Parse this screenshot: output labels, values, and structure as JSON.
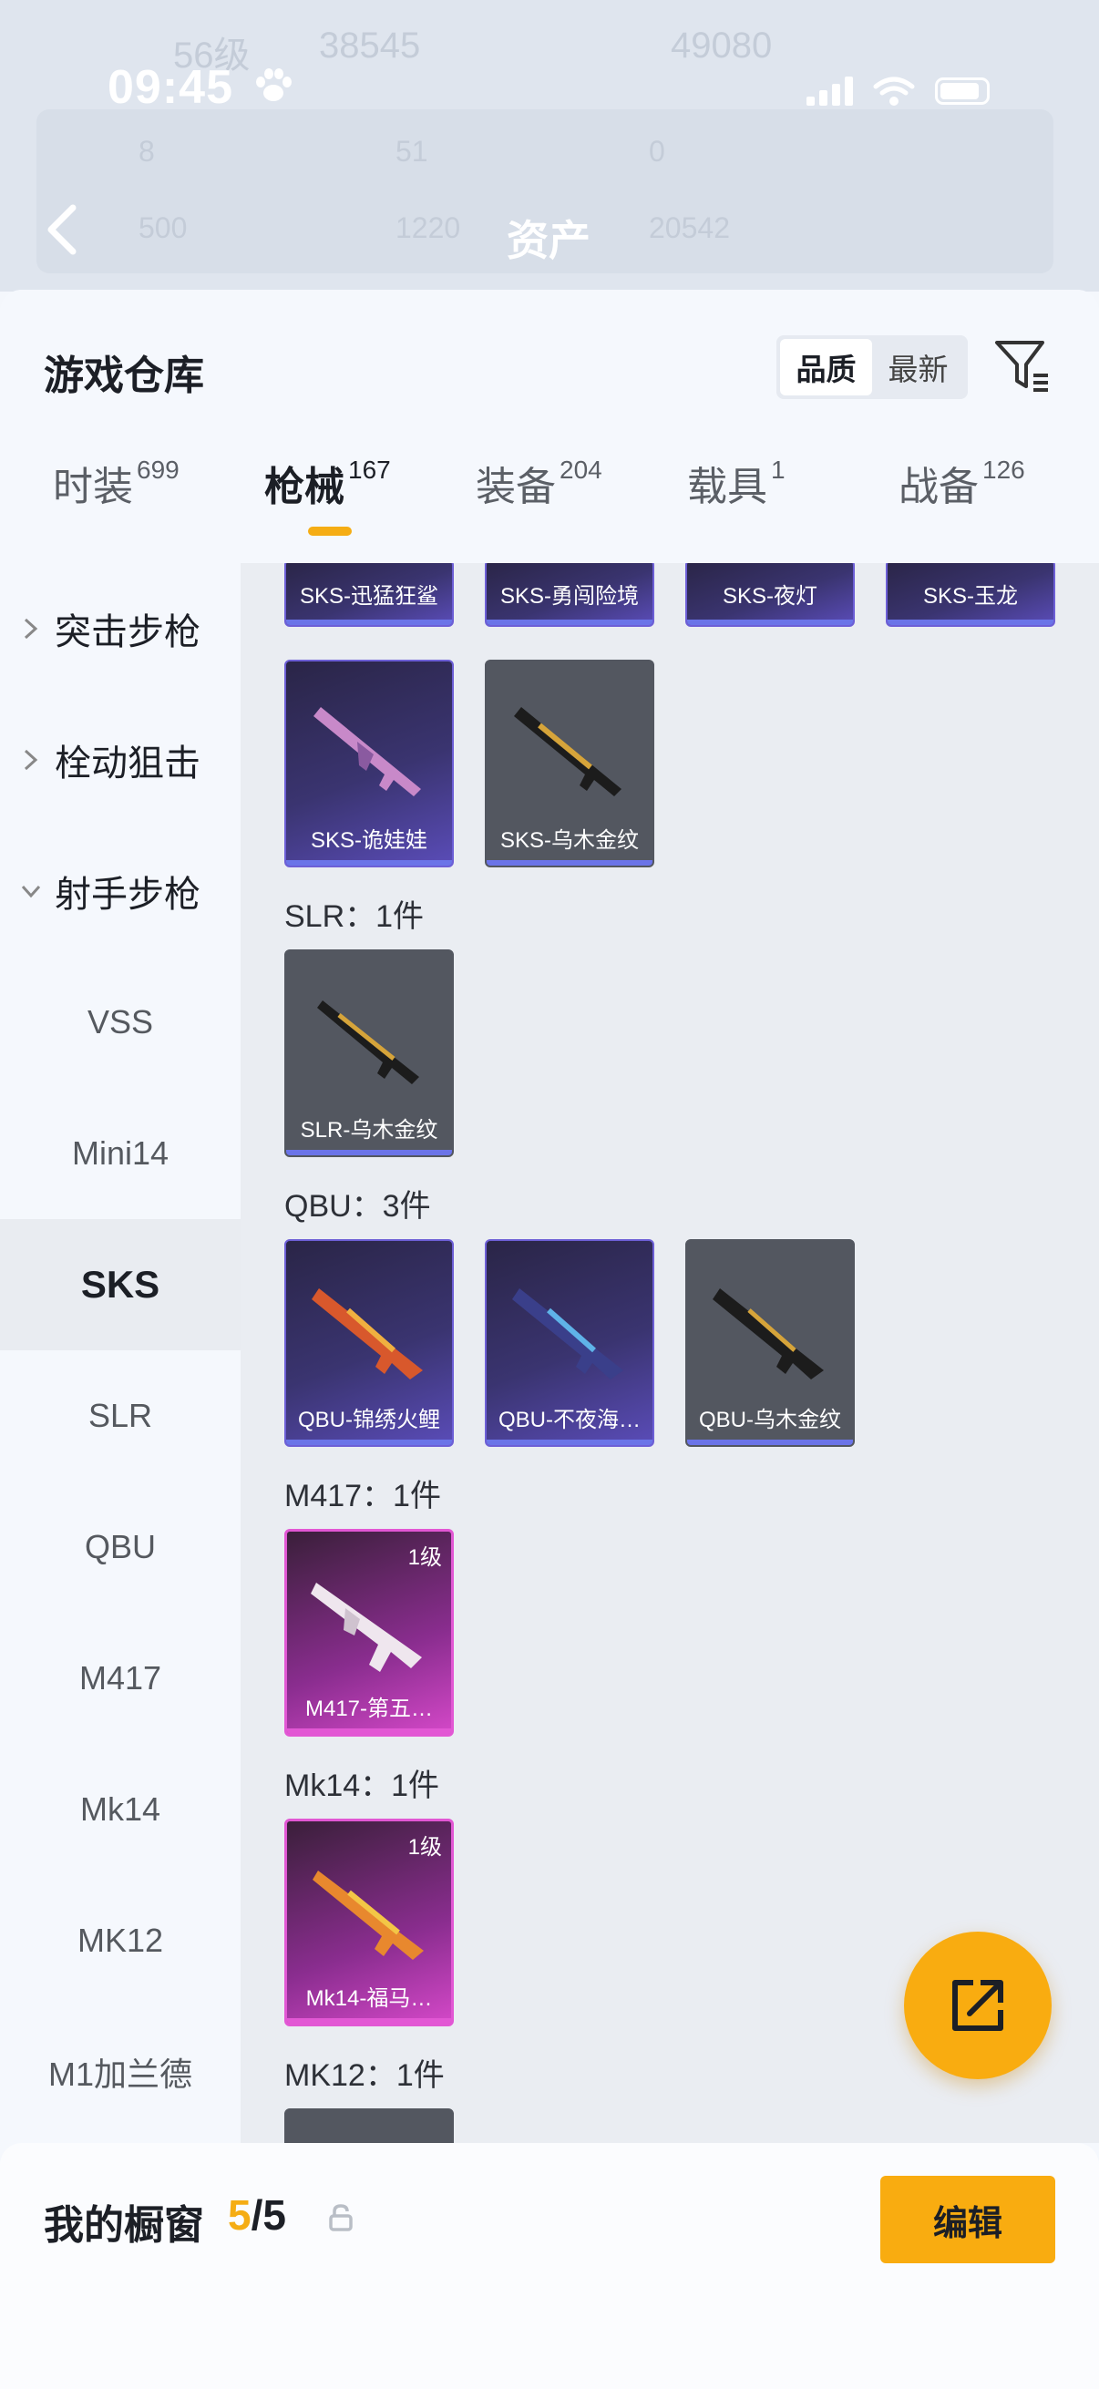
{
  "status_bar": {
    "time": "09:45",
    "level_text": "56级",
    "score_left": "38545",
    "score_right": "49080"
  },
  "background_page": {
    "title": "资产",
    "stats_row1": [
      "8",
      "51",
      "0"
    ],
    "stats_row2": [
      "500",
      "1220",
      "20542"
    ]
  },
  "sheet": {
    "title": "游戏仓库",
    "sort_options": [
      "品质",
      "最新"
    ],
    "sort_selected": "品质"
  },
  "tabs": [
    {
      "label": "时装",
      "count": "699"
    },
    {
      "label": "枪械",
      "count": "167",
      "active": true
    },
    {
      "label": "装备",
      "count": "204"
    },
    {
      "label": "载具",
      "count": "1"
    },
    {
      "label": "战备",
      "count": "126"
    }
  ],
  "categories": {
    "groups": [
      {
        "label": "突击步枪",
        "expanded": false
      },
      {
        "label": "栓动狙击",
        "expanded": false
      },
      {
        "label": "射手步枪",
        "expanded": true
      }
    ],
    "subitems": [
      "VSS",
      "Mini14",
      "SKS",
      "SLR",
      "QBU",
      "M417",
      "Mk14",
      "MK12",
      "M1加兰德"
    ],
    "selected": "SKS"
  },
  "content": {
    "sks_partial_row": [
      "SKS-迅猛狂鲨",
      "SKS-勇闯险境",
      "SKS-夜灯",
      "SKS-玉龙"
    ],
    "sks_row2": [
      "SKS-诡娃娃",
      "SKS-乌木金纹"
    ],
    "slr_header": "SLR：1件",
    "slr_items": [
      "SLR-乌木金纹"
    ],
    "qbu_header": "QBU：3件",
    "qbu_items": [
      "QBU-锦绣火鲤",
      "QBU-不夜海…",
      "QBU-乌木金纹"
    ],
    "m417_header": "M417：1件",
    "m417_items": [
      "M417-第五…"
    ],
    "mk14_header": "Mk14：1件",
    "mk14_items": [
      "Mk14-福马…"
    ],
    "mk12_header": "MK12：1件",
    "level_badge": "1级"
  },
  "showcase": {
    "title": "我的橱窗",
    "current": "5",
    "separator": "/",
    "max": "5",
    "edit_label": "编辑"
  },
  "colors": {
    "accent": "#f9ac10",
    "purple_rarity": "#6d5fd6",
    "pink_rarity": "#e257d4",
    "gray_rarity": "#535760"
  }
}
